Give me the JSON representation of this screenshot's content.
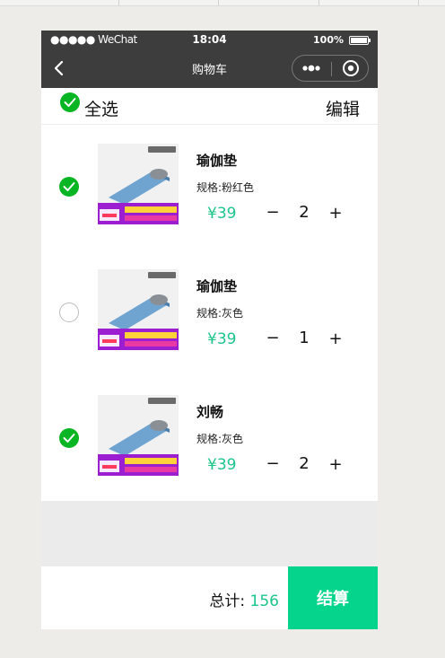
{
  "status_bar": {
    "carrier": "●●●●● WeChat",
    "time": "18:04",
    "battery": "100%"
  },
  "navbar": {
    "title": "购物车"
  },
  "toolbar": {
    "select_all_label": "全选",
    "select_all_checked": true,
    "edit_label": "编辑"
  },
  "items": [
    {
      "name": "瑜伽垫",
      "spec_label": "规格:",
      "spec_value": "粉红色",
      "price": "¥39",
      "minus": "−",
      "quantity": "2",
      "plus": "+",
      "checked": true
    },
    {
      "name": "瑜伽垫",
      "spec_label": "规格:",
      "spec_value": "灰色",
      "price": "¥39",
      "minus": "−",
      "quantity": "1",
      "plus": "+",
      "checked": false
    },
    {
      "name": "刘畅",
      "spec_label": "规格:",
      "spec_value": "灰色",
      "price": "¥39",
      "minus": "−",
      "quantity": "2",
      "plus": "+",
      "checked": true
    }
  ],
  "footer": {
    "total_label": "总计:",
    "total_value": "156",
    "checkout_label": "结算"
  },
  "colors": {
    "accent": "#1cc58a",
    "checkout": "#04d48c",
    "check_on": "#08b523",
    "nav": "#3d3d3d"
  },
  "icons": {
    "back": "chevron-left-icon",
    "more": "more-dots-icon",
    "close": "target-close-icon",
    "check": "checkmark-icon"
  }
}
